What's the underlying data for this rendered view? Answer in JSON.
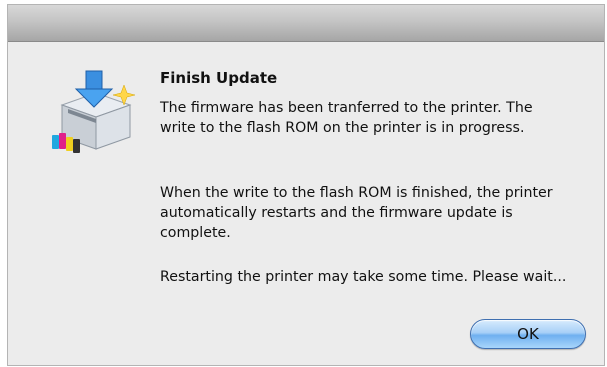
{
  "dialog": {
    "title": "Finish Update",
    "paragraphs": [
      "The firmware has been tranferred to the printer. The write to the flash ROM on the printer is in progress.",
      "When the write to the flash ROM is finished, the printer automatically restarts and the firmware update is complete.",
      "Restarting the printer may take some time. Please wait..."
    ],
    "ok_label": "OK",
    "icon": "printer-update-icon"
  },
  "colors": {
    "dialog_bg": "#ececec",
    "button_blue": "#7ab8f5"
  }
}
